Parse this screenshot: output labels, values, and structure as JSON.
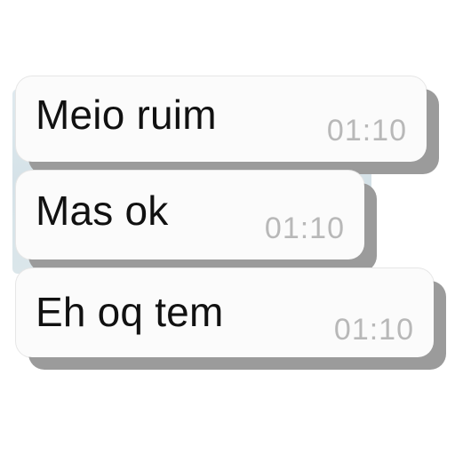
{
  "messages": [
    {
      "text": "Meio ruim",
      "time": "01:10"
    },
    {
      "text": "Mas ok",
      "time": "01:10"
    },
    {
      "text": "Eh oq tem",
      "time": "01:10"
    }
  ],
  "colors": {
    "bubble": "#fbfbfb",
    "shadow": "#9b9b9b",
    "text": "#111111",
    "timestamp": "#b8b8b8",
    "chat_background": "#d5e2e8"
  }
}
